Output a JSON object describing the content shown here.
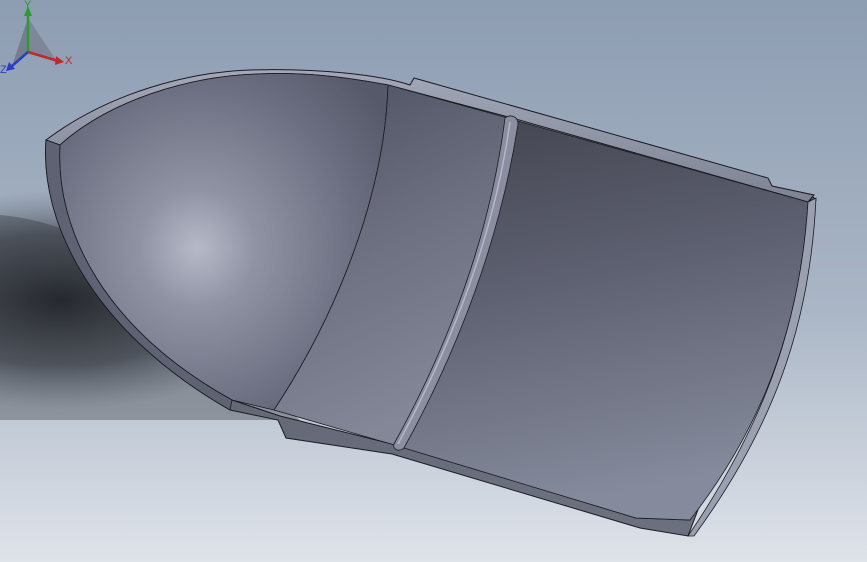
{
  "viewport": {
    "background_top": "#8fa0b4",
    "background_bottom": "#dde2ea",
    "part_color": "#6f7384",
    "edge_color": "#1a1b22"
  },
  "triad": {
    "x_label": "X",
    "y_label": "Y",
    "z_label": "Z",
    "x_color": "#c0282a",
    "y_color": "#2f9a2f",
    "z_color": "#2a3fc0"
  }
}
